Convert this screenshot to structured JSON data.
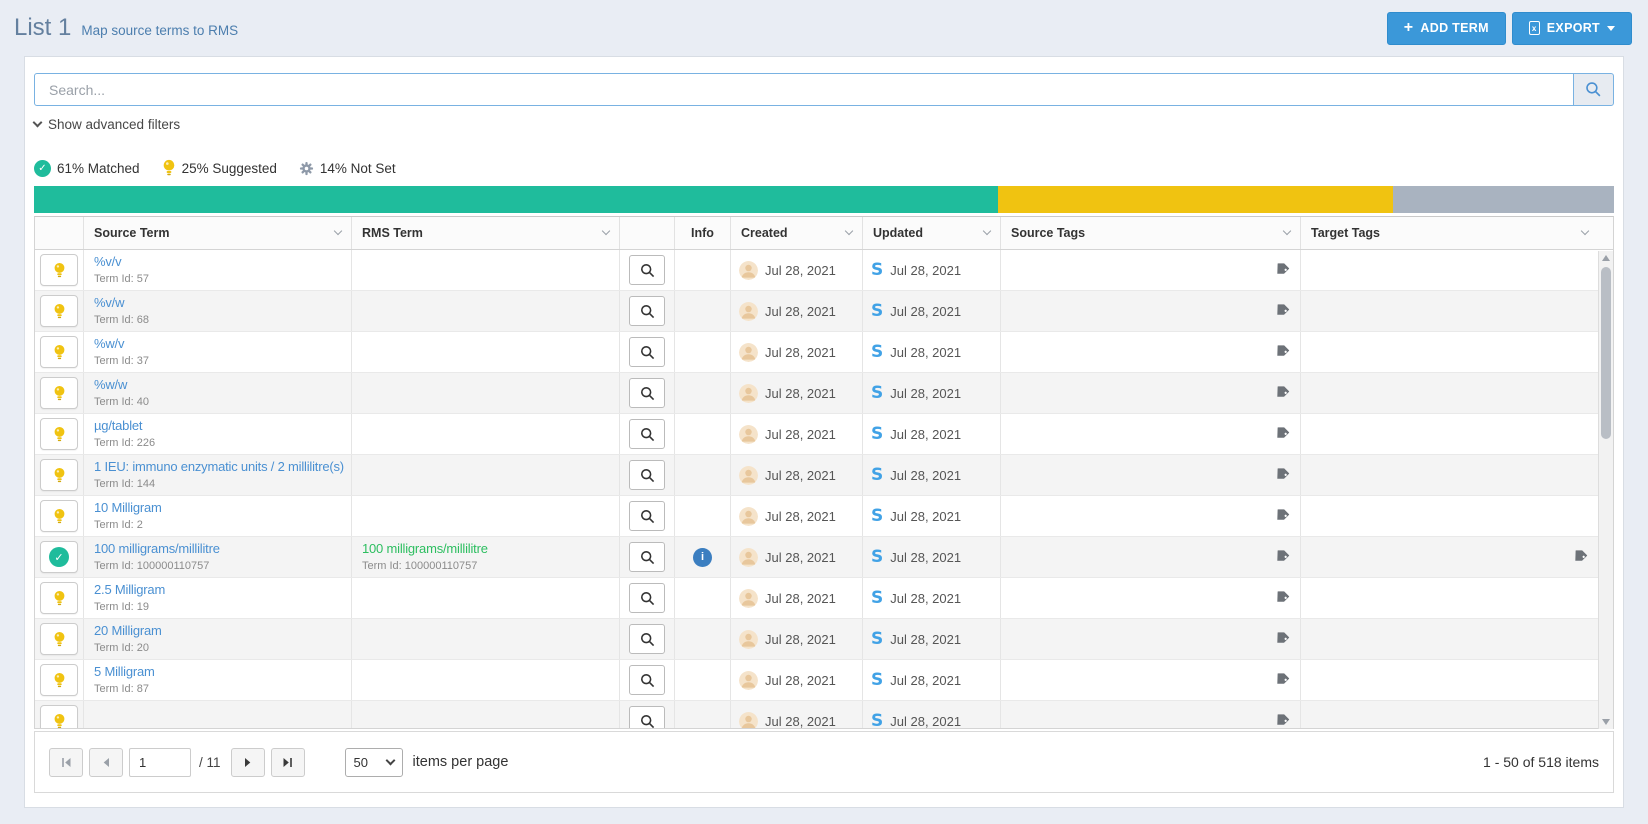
{
  "header": {
    "title": "List 1",
    "subtitle": "Map source terms to RMS",
    "buttons": {
      "add_term": "ADD TERM",
      "export": "EXPORT"
    },
    "accent_color": "#3b98d9"
  },
  "search": {
    "placeholder": "Search..."
  },
  "filters": {
    "show_advanced_label": "Show advanced filters"
  },
  "progress": {
    "segments": [
      {
        "name": "matched",
        "pct": 61,
        "label": "61% Matched",
        "color": "#1fbc9c",
        "icon": "check-circle-icon"
      },
      {
        "name": "suggested",
        "pct": 25,
        "label": "25% Suggested",
        "color": "#f0c311",
        "icon": "lightbulb-icon"
      },
      {
        "name": "not_set",
        "pct": 14,
        "label": "14% Not Set",
        "color": "#a9b3c0",
        "icon": "gear-icon"
      }
    ]
  },
  "table": {
    "columns": [
      {
        "key": "status",
        "label": "",
        "sortable": false
      },
      {
        "key": "source_term",
        "label": "Source Term",
        "sortable": true
      },
      {
        "key": "rms_term",
        "label": "RMS Term",
        "sortable": true
      },
      {
        "key": "zoom",
        "label": "",
        "sortable": false
      },
      {
        "key": "info",
        "label": "Info",
        "sortable": false
      },
      {
        "key": "created",
        "label": "Created",
        "sortable": true
      },
      {
        "key": "updated",
        "label": "Updated",
        "sortable": true
      },
      {
        "key": "source_tags",
        "label": "Source Tags",
        "sortable": true
      },
      {
        "key": "target_tags",
        "label": "Target Tags",
        "sortable": true
      }
    ],
    "link_color": "#4a90d2",
    "matched_color": "#2dbe60",
    "rows": [
      {
        "status": "suggested",
        "source_term": "%v/v",
        "source_term_id": "Term Id: 57",
        "rms_term": "",
        "rms_term_id": "",
        "info": false,
        "created": "Jul 28, 2021",
        "updated": "Jul 28, 2021",
        "source_tag": true,
        "target_tag": false
      },
      {
        "status": "suggested",
        "source_term": "%v/w",
        "source_term_id": "Term Id: 68",
        "rms_term": "",
        "rms_term_id": "",
        "info": false,
        "created": "Jul 28, 2021",
        "updated": "Jul 28, 2021",
        "source_tag": true,
        "target_tag": false
      },
      {
        "status": "suggested",
        "source_term": "%w/v",
        "source_term_id": "Term Id: 37",
        "rms_term": "",
        "rms_term_id": "",
        "info": false,
        "created": "Jul 28, 2021",
        "updated": "Jul 28, 2021",
        "source_tag": true,
        "target_tag": false
      },
      {
        "status": "suggested",
        "source_term": "%w/w",
        "source_term_id": "Term Id: 40",
        "rms_term": "",
        "rms_term_id": "",
        "info": false,
        "created": "Jul 28, 2021",
        "updated": "Jul 28, 2021",
        "source_tag": true,
        "target_tag": false
      },
      {
        "status": "suggested",
        "source_term": "µg/tablet",
        "source_term_id": "Term Id: 226",
        "rms_term": "",
        "rms_term_id": "",
        "info": false,
        "created": "Jul 28, 2021",
        "updated": "Jul 28, 2021",
        "source_tag": true,
        "target_tag": false
      },
      {
        "status": "suggested",
        "source_term": "1 IEU: immuno enzymatic units / 2 millilitre(s)",
        "source_term_id": "Term Id: 144",
        "rms_term": "",
        "rms_term_id": "",
        "info": false,
        "created": "Jul 28, 2021",
        "updated": "Jul 28, 2021",
        "source_tag": true,
        "target_tag": false
      },
      {
        "status": "suggested",
        "source_term": "10 Milligram",
        "source_term_id": "Term Id: 2",
        "rms_term": "",
        "rms_term_id": "",
        "info": false,
        "created": "Jul 28, 2021",
        "updated": "Jul 28, 2021",
        "source_tag": true,
        "target_tag": false
      },
      {
        "status": "matched",
        "source_term": "100 milligrams/millilitre",
        "source_term_id": "Term Id: 100000110757",
        "rms_term": "100 milligrams/millilitre",
        "rms_term_id": "Term Id: 100000110757",
        "info": true,
        "created": "Jul 28, 2021",
        "updated": "Jul 28, 2021",
        "source_tag": true,
        "target_tag": true
      },
      {
        "status": "suggested",
        "source_term": "2.5 Milligram",
        "source_term_id": "Term Id: 19",
        "rms_term": "",
        "rms_term_id": "",
        "info": false,
        "created": "Jul 28, 2021",
        "updated": "Jul 28, 2021",
        "source_tag": true,
        "target_tag": false
      },
      {
        "status": "suggested",
        "source_term": "20 Milligram",
        "source_term_id": "Term Id: 20",
        "rms_term": "",
        "rms_term_id": "",
        "info": false,
        "created": "Jul 28, 2021",
        "updated": "Jul 28, 2021",
        "source_tag": true,
        "target_tag": false
      },
      {
        "status": "suggested",
        "source_term": "5 Milligram",
        "source_term_id": "Term Id: 87",
        "rms_term": "",
        "rms_term_id": "",
        "info": false,
        "created": "Jul 28, 2021",
        "updated": "Jul 28, 2021",
        "source_tag": true,
        "target_tag": false
      },
      {
        "status": "suggested",
        "source_term": "",
        "source_term_id": "",
        "rms_term": "",
        "rms_term_id": "",
        "info": false,
        "created": "Jul 28, 2021",
        "updated": "Jul 28, 2021",
        "source_tag": true,
        "target_tag": false,
        "partial": true
      }
    ]
  },
  "pagination": {
    "page": "1",
    "total_pages_label": "/ 11",
    "page_size": "50",
    "items_per_page_label": "items per page",
    "range_label": "1 - 50 of 518 items"
  }
}
